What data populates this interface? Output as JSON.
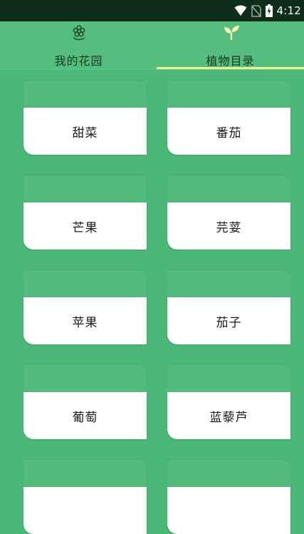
{
  "status_bar": {
    "time": "4:12",
    "icons": [
      "wifi-icon",
      "no-sim-icon",
      "battery-charging-icon"
    ]
  },
  "tabs": [
    {
      "label": "我的花园",
      "icon": "flower-icon",
      "selected": false
    },
    {
      "label": "植物目录",
      "icon": "sprout-icon",
      "selected": true
    }
  ],
  "plants": [
    {
      "name": "甜菜"
    },
    {
      "name": "番茄"
    },
    {
      "name": "芒果"
    },
    {
      "name": "芫荽"
    },
    {
      "name": "苹果"
    },
    {
      "name": "茄子"
    },
    {
      "name": "葡萄"
    },
    {
      "name": "蓝藜芦"
    },
    {
      "name": ""
    },
    {
      "name": ""
    }
  ],
  "colors": {
    "background": "#4bb878",
    "status_bar": "#0e2e1a",
    "tab_indicator": "#e8f39c",
    "card": "#ffffff"
  }
}
